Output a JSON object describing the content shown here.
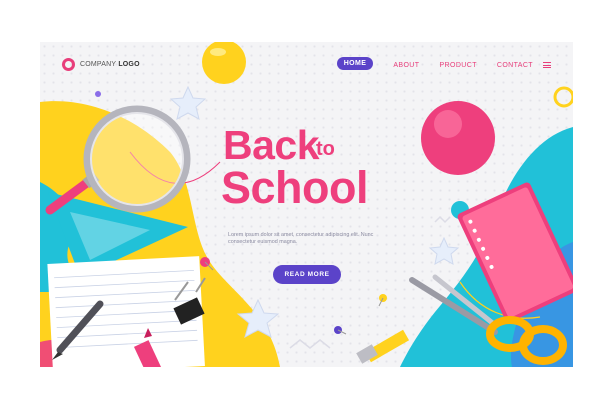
{
  "header": {
    "logo": {
      "text_regular": "COMPANY",
      "text_bold": "LOGO",
      "icon": "ring-icon"
    },
    "nav": [
      {
        "label": "HOME",
        "active": true
      },
      {
        "label": "ABOUT",
        "active": false
      },
      {
        "label": "PRODUCT",
        "active": false
      },
      {
        "label": "CONTACT",
        "active": false
      }
    ],
    "menu_icon": "hamburger-menu-icon"
  },
  "hero": {
    "title_back": "Back",
    "title_to": "to",
    "title_school": "School",
    "description": "Lorem ipsum dolor sit amet, consectetur adipiscing elit. Nunc consectetur euismod magna.",
    "cta_label": "READ MORE"
  },
  "decorations": [
    "magnifying-glass-icon",
    "ruler-icon",
    "notebook-icon",
    "pencil-icon",
    "crayon-icon",
    "binder-clip-icon",
    "push-pin-icon",
    "scissors-icon",
    "spiral-notebook-icon",
    "ball-icon"
  ],
  "colors": {
    "accent_pink": "#ee3f7d",
    "brand_purple": "#5b43c9",
    "yellow": "#ffd21e",
    "teal": "#21c1d8"
  }
}
